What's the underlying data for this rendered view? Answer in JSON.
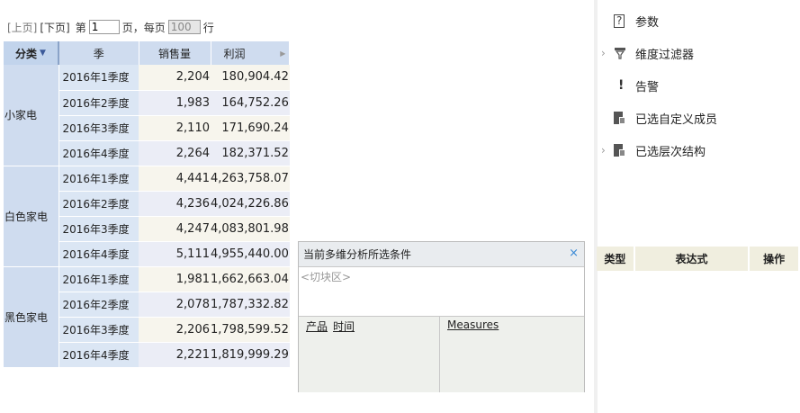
{
  "pager": {
    "prev": "[上页]",
    "next": "[下页]",
    "page_prefix": "第",
    "page_value": "1",
    "page_suffix": "页，每页",
    "page_size": "100",
    "row_suffix": "行"
  },
  "pivot": {
    "headers": {
      "category": "分类",
      "quarter": "季",
      "sales": "销售量",
      "profit": "利润"
    },
    "groups": [
      {
        "name": "小家电",
        "rows": [
          {
            "quarter": "2016年1季度",
            "sales": "2,204",
            "profit": "180,904.42"
          },
          {
            "quarter": "2016年2季度",
            "sales": "1,983",
            "profit": "164,752.26"
          },
          {
            "quarter": "2016年3季度",
            "sales": "2,110",
            "profit": "171,690.24"
          },
          {
            "quarter": "2016年4季度",
            "sales": "2,264",
            "profit": "182,371.52"
          }
        ]
      },
      {
        "name": "白色家电",
        "rows": [
          {
            "quarter": "2016年1季度",
            "sales": "4,441",
            "profit": "4,263,758.07"
          },
          {
            "quarter": "2016年2季度",
            "sales": "4,236",
            "profit": "4,024,226.86"
          },
          {
            "quarter": "2016年3季度",
            "sales": "4,247",
            "profit": "4,083,801.98"
          },
          {
            "quarter": "2016年4季度",
            "sales": "5,111",
            "profit": "4,955,440.00"
          }
        ]
      },
      {
        "name": "黑色家电",
        "rows": [
          {
            "quarter": "2016年1季度",
            "sales": "1,981",
            "profit": "1,662,663.04"
          },
          {
            "quarter": "2016年2季度",
            "sales": "2,078",
            "profit": "1,787,332.82"
          },
          {
            "quarter": "2016年3季度",
            "sales": "2,206",
            "profit": "1,798,599.52"
          },
          {
            "quarter": "2016年4季度",
            "sales": "2,221",
            "profit": "1,819,999.29"
          }
        ]
      }
    ]
  },
  "conditions": {
    "title": "当前多维分析所选条件",
    "close": "×",
    "slice_label": "<切块区>",
    "rows": [
      "产品",
      "时间"
    ],
    "columns": [
      "Measures"
    ]
  },
  "side_panel": {
    "items": [
      {
        "label": "参数",
        "icon": "question-icon",
        "expandable": false
      },
      {
        "label": "维度过滤器",
        "icon": "filter-icon",
        "expandable": true
      },
      {
        "label": "告警",
        "icon": "exclamation-icon",
        "expandable": false
      },
      {
        "label": "已选自定义成员",
        "icon": "document-icon",
        "expandable": false
      },
      {
        "label": "已选层次结构",
        "icon": "document-icon",
        "expandable": true
      }
    ],
    "expr_table": {
      "type": "类型",
      "expression": "表达式",
      "action": "操作"
    }
  },
  "colors": {
    "header_bg": "#cfdcef",
    "value_bg_a": "#f7f5ed",
    "value_bg_b": "#ebedf6",
    "expr_header_bg": "#f0eedf"
  }
}
